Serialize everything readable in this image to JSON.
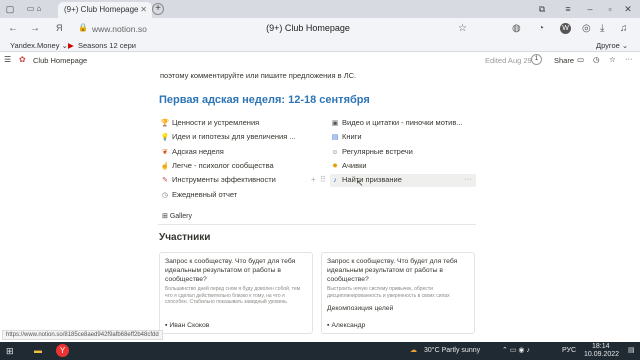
{
  "browser": {
    "tab_title": "(9+) Club Homepage",
    "url_host": "www.notion.so",
    "page_title": "(9+) Club Homepage",
    "bookmarks": [
      {
        "label": "Yandex.Money"
      },
      {
        "label": "Seasons 12 сери"
      }
    ],
    "other_bookmarks": "Другое"
  },
  "notion": {
    "breadcrumb": "Club Homepage",
    "edited": "Edited Aug 29",
    "share": "Share"
  },
  "page": {
    "intro": "поэтому комментируйте или пишите предложения в ЛС.",
    "heading": "Первая адская неделя: 12-18 сентября",
    "left_links": [
      "Ценности и устремления",
      "Идеи и гипотезы для увеличения ...",
      "Адская неделя",
      "Легче - психолог сообщества",
      "Инструменты эффективности",
      "Ежедневный отчет"
    ],
    "right_links": [
      "Видео и цитатки - пиночки мотив...",
      "Книги",
      "Регулярные встречи",
      "Ачивки",
      "Найти призвание"
    ],
    "gallery_tab": "Gallery",
    "members_heading": "Участники",
    "cards": [
      {
        "question": "Запрос к сообществу. Что будет для тебя идеальным результатом от работы в сообществе?",
        "desc": "Большинство дней перед сном я буду доволен собой, тем что я сделал действительно близко к тому, на что я способен. Стабильно показывать завидный уровень",
        "author": "Иван Скоков"
      },
      {
        "question": "Запрос к сообществу. Что будет для тебя идеальным результатом от работы в сообществе?",
        "desc": "Выстроить нячую систему привычек, обрести дисциплинированность и уверенность в своих силах",
        "author": "Александр",
        "tag": "Декомпозиция целей"
      }
    ]
  },
  "status_url": "https://www.notion.so/8185ce8aed942f9afb68eff2b48cfdd",
  "taskbar": {
    "weather": "30°C  Partly sunny",
    "lang": "РУС",
    "time": "18:14",
    "date": "10.09.2022"
  },
  "colors": {
    "accent": "#2e75b5",
    "taskbar": "#1f2a33"
  }
}
